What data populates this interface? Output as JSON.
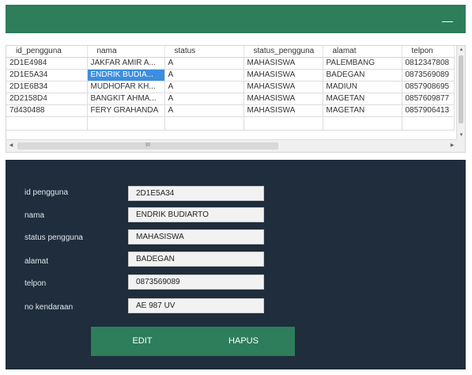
{
  "window": {
    "minimize_glyph": "—"
  },
  "grid": {
    "columns": [
      "id_pengguna",
      "nama",
      "status",
      "status_pengguna",
      "alamat",
      "telpon"
    ],
    "rows": [
      [
        "2D1E4984",
        "JAKFAR AMIR A...",
        "A",
        "MAHASISWA",
        "PALEMBANG",
        "0812347808"
      ],
      [
        "2D1E5A34",
        "ENDRIK BUDIA...",
        "A",
        "MAHASISWA",
        "BADEGAN",
        "0873569089"
      ],
      [
        "2D1E6B34",
        "MUDHOFAR KH...",
        "A",
        "MAHASISWA",
        "MADIUN",
        "0857908695"
      ],
      [
        "2D2158D4",
        "BANGKIT AHMA...",
        "A",
        "MAHASISWA",
        "MAGETAN",
        "0857609877"
      ],
      [
        "7d430488",
        "FERY GRAHANDA",
        "A",
        "MAHASISWA",
        "MAGETAN",
        "0857906413"
      ]
    ],
    "selected_row": 1,
    "hscroll_grip": "III"
  },
  "form": {
    "fields": [
      {
        "label": "id pengguna",
        "value": "2D1E5A34"
      },
      {
        "label": "nama",
        "value": "ENDRIK BUDIARTO"
      },
      {
        "label": "status pengguna",
        "value": "MAHASISWA"
      },
      {
        "label": "alamat",
        "value": "BADEGAN"
      },
      {
        "label": "telpon",
        "value": "0873569089"
      },
      {
        "label": "no kendaraan",
        "value": "AE 987 UV"
      }
    ],
    "edit_label": "EDIT",
    "delete_label": "HAPUS"
  },
  "colors": {
    "accent": "#2e7d5b",
    "panel": "#1f2d3c",
    "selection": "#3b8ee0"
  }
}
